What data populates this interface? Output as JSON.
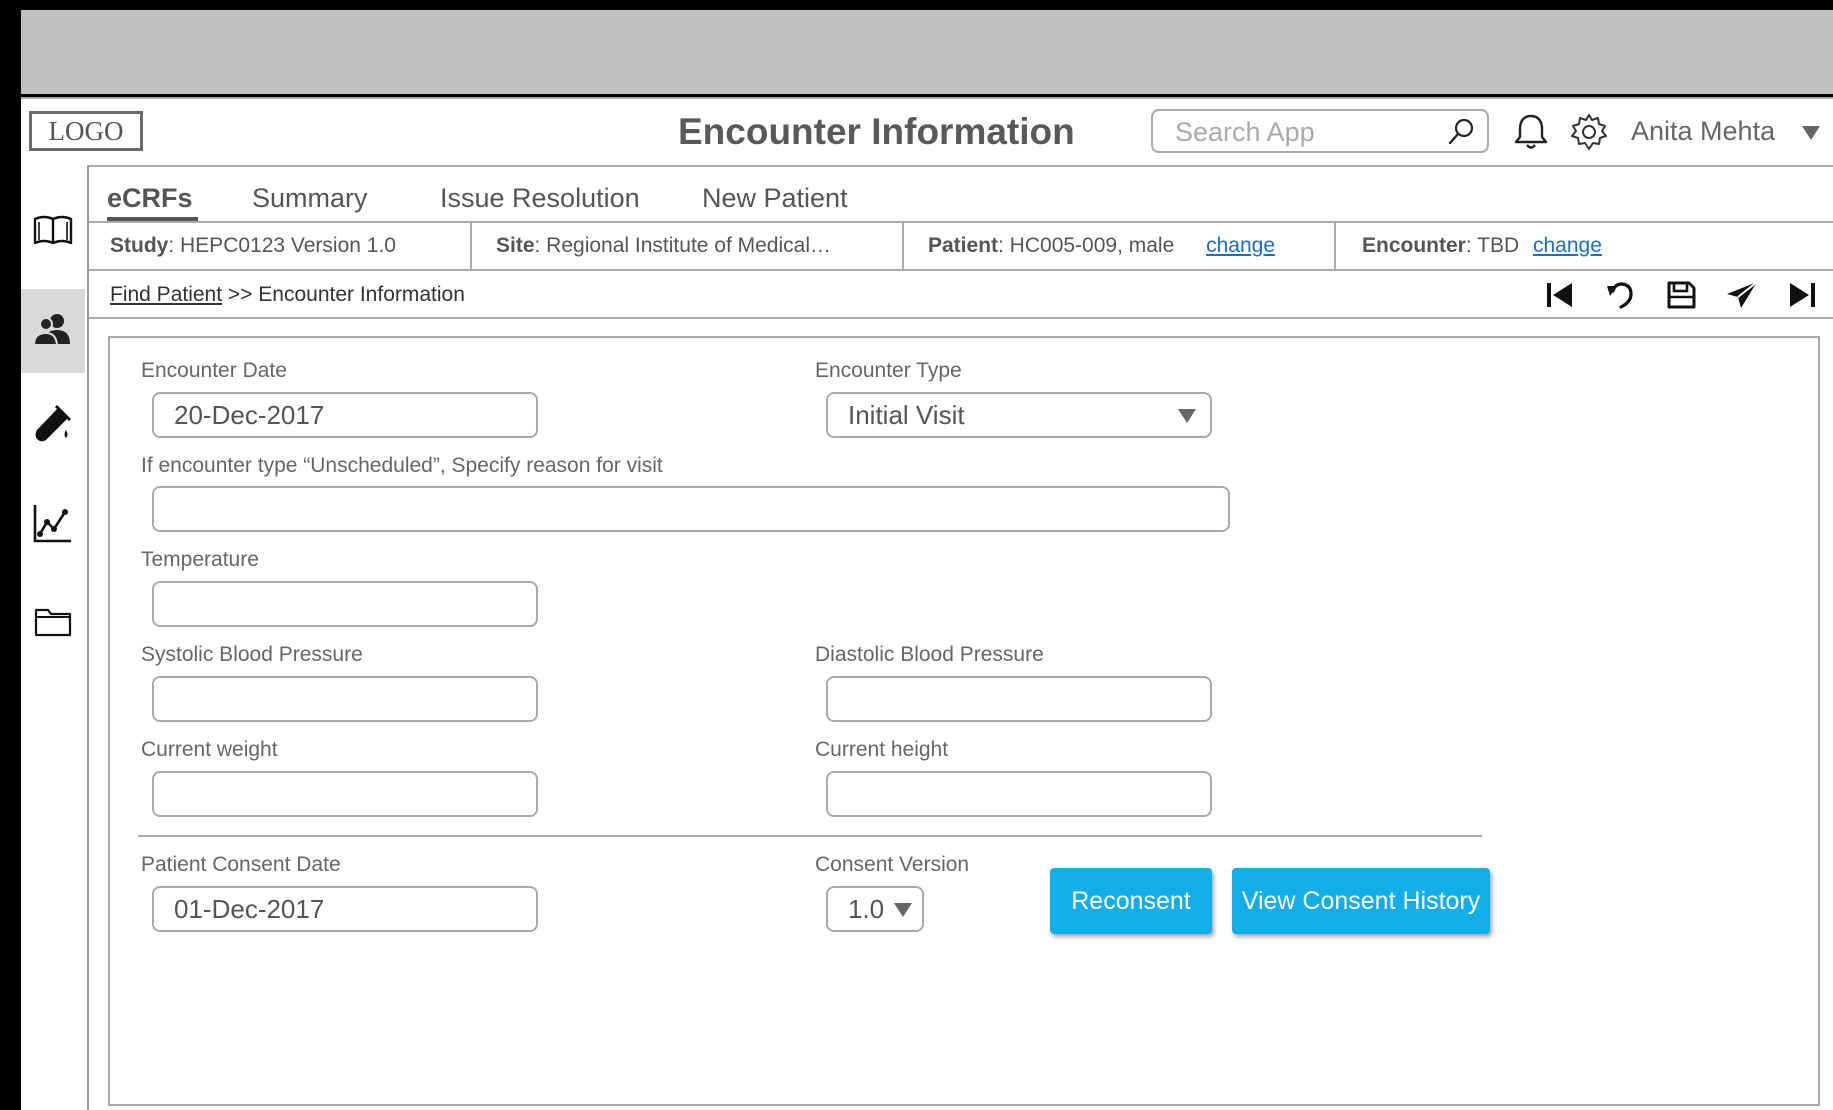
{
  "header": {
    "logo": "LOGO",
    "title": "Encounter Information",
    "search_placeholder": "Search App",
    "user_name": "Anita Mehta"
  },
  "sidebar": {
    "items": [
      {
        "icon": "book-icon",
        "active": false
      },
      {
        "icon": "users-icon",
        "active": true
      },
      {
        "icon": "lab-flask-icon",
        "active": false
      },
      {
        "icon": "line-chart-icon",
        "active": false
      },
      {
        "icon": "folder-icon",
        "active": false
      }
    ]
  },
  "tabs": [
    {
      "label": "eCRFs",
      "active": true
    },
    {
      "label": "Summary",
      "active": false
    },
    {
      "label": "Issue Resolution",
      "active": false
    },
    {
      "label": "New Patient",
      "active": false
    }
  ],
  "infobar": {
    "study_label": "Study",
    "study_value": ": HEPC0123 Version 1.0",
    "site_label": "Site",
    "site_value": ": Regional Institute of Medical…",
    "patient_label": "Patient",
    "patient_value": ": HC005-009, male",
    "patient_change": "change",
    "encounter_label": "Encounter",
    "encounter_value": ": TBD",
    "encounter_change": "change"
  },
  "breadcrumb": {
    "link": "Find Patient",
    "separator": " >> ",
    "current": "Encounter Information"
  },
  "toolbar": {
    "icons": [
      "skip-first-icon",
      "undo-icon",
      "save-icon",
      "send-icon",
      "skip-last-icon"
    ]
  },
  "form": {
    "encounter_date_label": "Encounter Date",
    "encounter_date_value": "20-Dec-2017",
    "encounter_type_label": "Encounter Type",
    "encounter_type_value": "Initial Visit",
    "reason_label": "If encounter type “Unscheduled”, Specify reason for visit",
    "reason_value": "",
    "temperature_label": "Temperature",
    "temperature_value": "",
    "systolic_label": "Systolic Blood Pressure",
    "systolic_value": "",
    "diastolic_label": "Diastolic Blood Pressure",
    "diastolic_value": "",
    "weight_label": "Current weight",
    "weight_value": "",
    "height_label": "Current height",
    "height_value": "",
    "consent_date_label": "Patient Consent Date",
    "consent_date_value": "01-Dec-2017",
    "consent_version_label": "Consent Version",
    "consent_version_value": "1.0",
    "reconsent_button": "Reconsent",
    "history_button": "View Consent History"
  },
  "colors": {
    "accent_button": "#11aeea",
    "link": "#1a6fc2",
    "active_sidebar": "#d9d9d9"
  }
}
